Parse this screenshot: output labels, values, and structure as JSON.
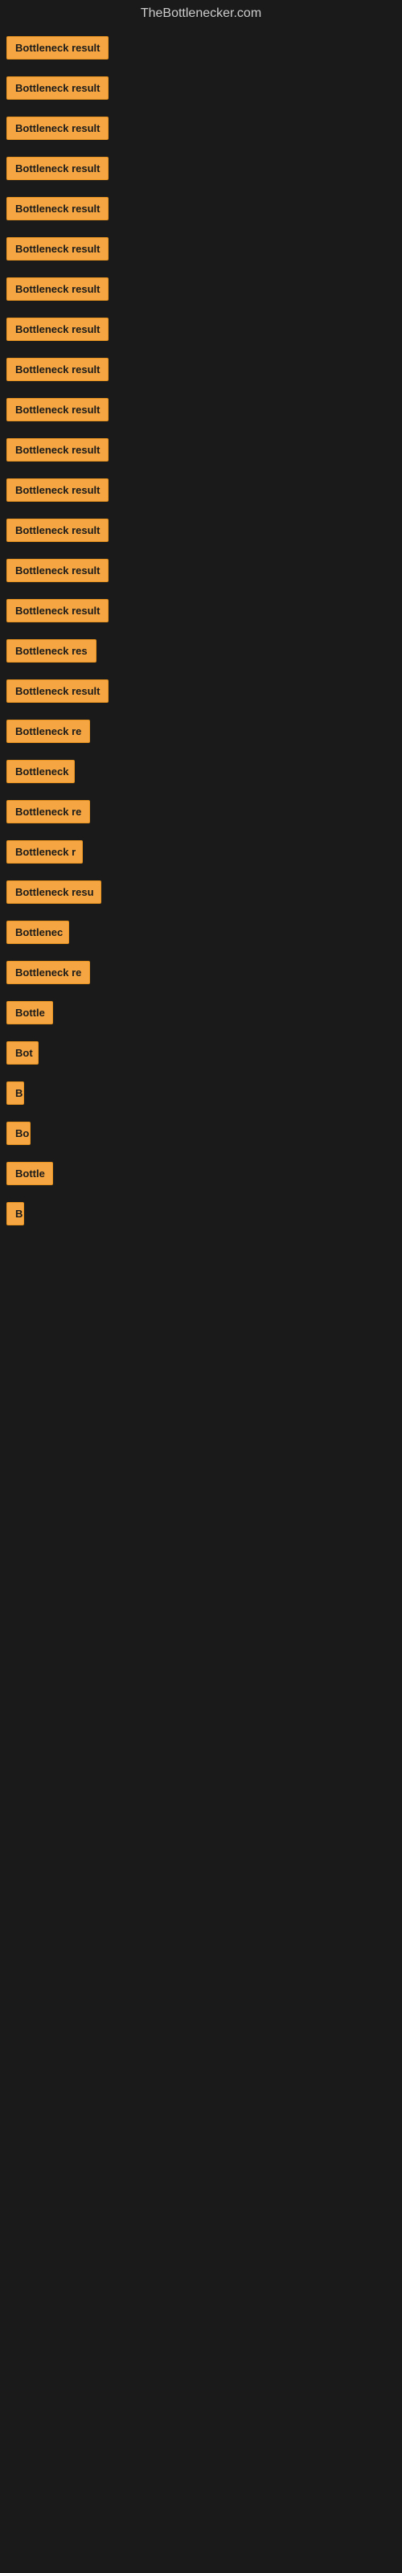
{
  "site": {
    "title": "TheBottlenecker.com"
  },
  "items": [
    {
      "label": "Bottleneck result",
      "width": 140
    },
    {
      "label": "Bottleneck result",
      "width": 140
    },
    {
      "label": "Bottleneck result",
      "width": 140
    },
    {
      "label": "Bottleneck result",
      "width": 140
    },
    {
      "label": "Bottleneck result",
      "width": 140
    },
    {
      "label": "Bottleneck result",
      "width": 140
    },
    {
      "label": "Bottleneck result",
      "width": 140
    },
    {
      "label": "Bottleneck result",
      "width": 140
    },
    {
      "label": "Bottleneck result",
      "width": 140
    },
    {
      "label": "Bottleneck result",
      "width": 140
    },
    {
      "label": "Bottleneck result",
      "width": 140
    },
    {
      "label": "Bottleneck result",
      "width": 140
    },
    {
      "label": "Bottleneck result",
      "width": 140
    },
    {
      "label": "Bottleneck result",
      "width": 140
    },
    {
      "label": "Bottleneck result",
      "width": 140
    },
    {
      "label": "Bottleneck res",
      "width": 115
    },
    {
      "label": "Bottleneck result",
      "width": 140
    },
    {
      "label": "Bottleneck re",
      "width": 105
    },
    {
      "label": "Bottleneck",
      "width": 85
    },
    {
      "label": "Bottleneck re",
      "width": 105
    },
    {
      "label": "Bottleneck r",
      "width": 95
    },
    {
      "label": "Bottleneck resu",
      "width": 118
    },
    {
      "label": "Bottlenec",
      "width": 78
    },
    {
      "label": "Bottleneck re",
      "width": 105
    },
    {
      "label": "Bottle",
      "width": 58
    },
    {
      "label": "Bot",
      "width": 40
    },
    {
      "label": "B",
      "width": 18
    },
    {
      "label": "Bo",
      "width": 30
    },
    {
      "label": "Bottle",
      "width": 58
    },
    {
      "label": "B",
      "width": 14
    }
  ]
}
